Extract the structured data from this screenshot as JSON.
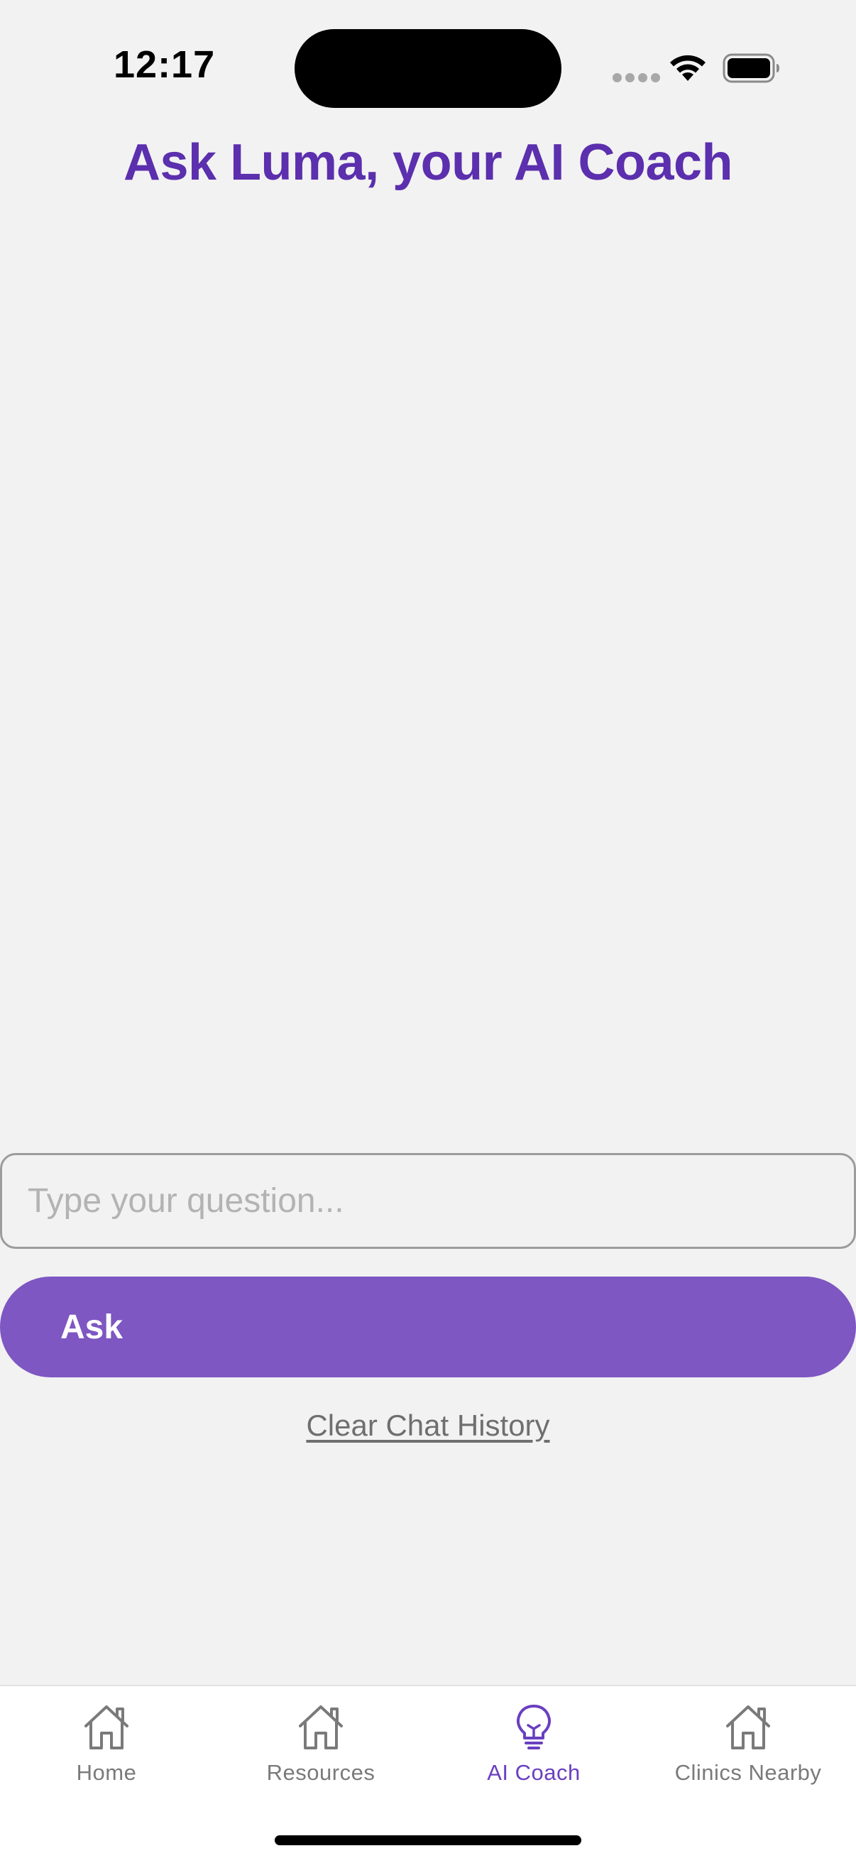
{
  "status_bar": {
    "time": "12:17"
  },
  "header": {
    "title": "Ask Luma, your AI Coach"
  },
  "chat": {
    "input_placeholder": "Type your question...",
    "input_value": "",
    "ask_label": "Ask",
    "clear_label": "Clear Chat History"
  },
  "tabs": [
    {
      "label": "Home",
      "icon": "house-icon",
      "active": false
    },
    {
      "label": "Resources",
      "icon": "house-icon",
      "active": false
    },
    {
      "label": "AI Coach",
      "icon": "lightbulb-icon",
      "active": true
    },
    {
      "label": "Clinics Nearby",
      "icon": "house-icon",
      "active": false
    }
  ],
  "colors": {
    "background": "#f2f2f2",
    "title": "#5b2fad",
    "primary_button": "#7e57c2",
    "active_tab": "#6a3fc0",
    "inactive_tab": "#7a7a7a"
  }
}
